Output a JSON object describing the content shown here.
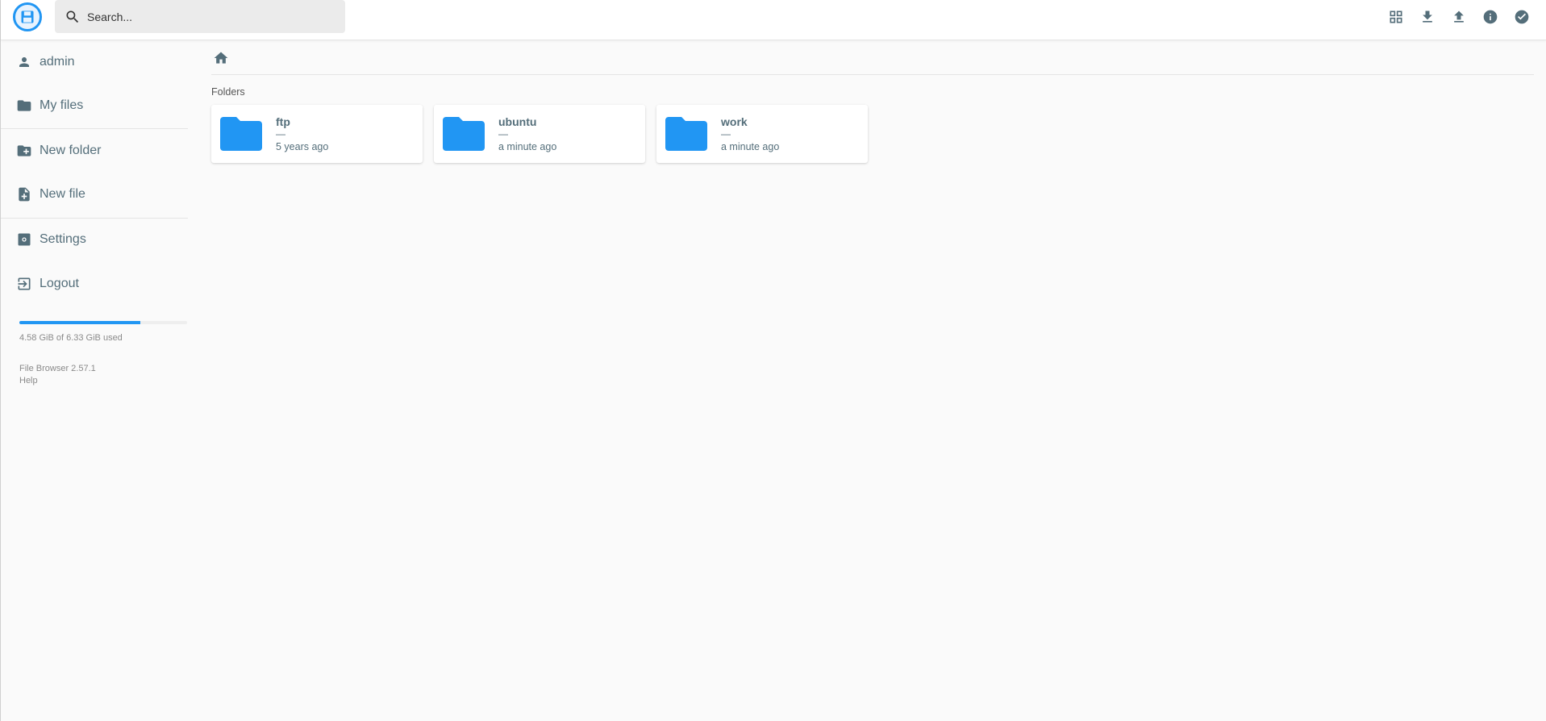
{
  "header": {
    "search_placeholder": "Search...",
    "actions": [
      "grid-view-icon",
      "download-icon",
      "upload-icon",
      "info-icon",
      "select-check-icon"
    ]
  },
  "sidebar": {
    "items": [
      {
        "label": "admin",
        "icon": "person-icon"
      },
      {
        "label": "My files",
        "icon": "folder-icon"
      },
      {
        "label": "New folder",
        "icon": "folder-plus-icon"
      },
      {
        "label": "New file",
        "icon": "file-plus-icon"
      },
      {
        "label": "Settings",
        "icon": "gear-icon"
      },
      {
        "label": "Logout",
        "icon": "logout-icon"
      }
    ],
    "usage": {
      "text": "4.58 GiB of 6.33 GiB used",
      "fraction": 0.7235
    },
    "version": "File Browser 2.57.1",
    "help": "Help"
  },
  "main": {
    "section_title": "Folders",
    "folders": [
      {
        "name": "ftp",
        "size": "—",
        "modified": "5 years ago"
      },
      {
        "name": "ubuntu",
        "size": "—",
        "modified": "a minute ago"
      },
      {
        "name": "work",
        "size": "—",
        "modified": "a minute ago"
      }
    ]
  },
  "colors": {
    "accent": "#2196f3",
    "text": "#546e7a",
    "background": "#fafafa"
  }
}
